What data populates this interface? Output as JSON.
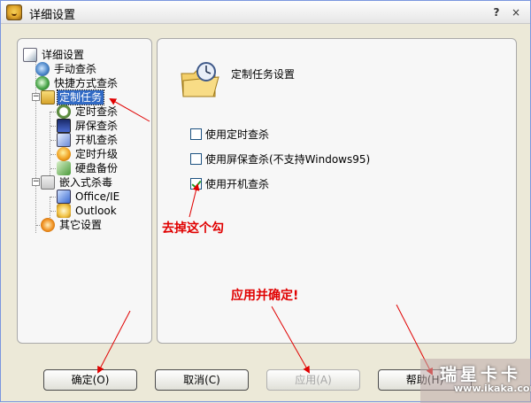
{
  "window": {
    "title": "详细设置",
    "help_glyph": "?",
    "close_glyph": "×"
  },
  "tree": {
    "root": "详细设置",
    "items": [
      {
        "label": "手动查杀",
        "icon": "magnifier-icon"
      },
      {
        "label": "快捷方式查杀",
        "icon": "shortcut-scan-icon"
      },
      {
        "label": "定制任务",
        "icon": "task-folder-icon",
        "selected": true,
        "children": [
          {
            "label": "定时查杀",
            "icon": "clock-icon"
          },
          {
            "label": "屏保查杀",
            "icon": "monitor-icon"
          },
          {
            "label": "开机查杀",
            "icon": "startup-icon"
          },
          {
            "label": "定时升级",
            "icon": "upgrade-icon"
          },
          {
            "label": "硬盘备份",
            "icon": "disk-backup-icon"
          }
        ]
      },
      {
        "label": "嵌入式杀毒",
        "icon": "embedded-icon",
        "children": [
          {
            "label": "Office/IE",
            "icon": "office-ie-icon"
          },
          {
            "label": "Outlook",
            "icon": "outlook-icon"
          }
        ]
      },
      {
        "label": "其它设置",
        "icon": "other-settings-icon"
      }
    ]
  },
  "main": {
    "section_title": "定制任务设置",
    "options": [
      {
        "label": "使用定时查杀",
        "checked": false
      },
      {
        "label": "使用屏保查杀(不支持Windows95)",
        "checked": false
      },
      {
        "label": "使用开机查杀",
        "checked": true
      }
    ]
  },
  "buttons": {
    "ok": "确定(O)",
    "cancel": "取消(C)",
    "apply": "应用(A)",
    "help": "帮助(H)"
  },
  "annotations": {
    "uncheck_note": "去掉这个勾",
    "apply_note": "应用并确定!"
  },
  "watermark": {
    "brand": "瑞星卡卡",
    "url": "www.ikaka.com"
  },
  "colors": {
    "annotation": "#e00000",
    "selection": "#316ac5"
  }
}
